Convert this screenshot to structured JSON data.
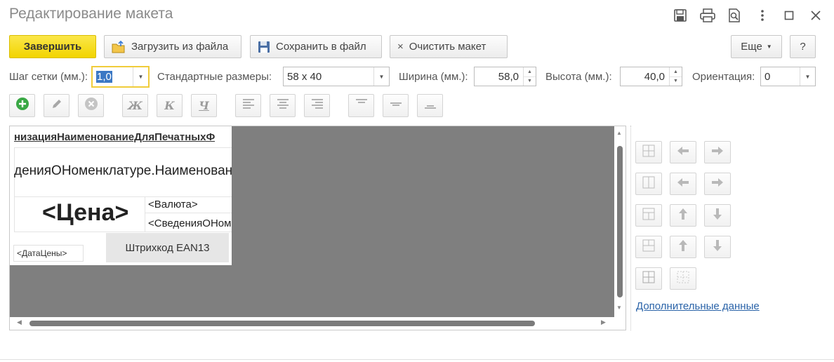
{
  "window": {
    "title": "Редактирование макета",
    "controls": [
      "save-icon",
      "print-icon",
      "preview-icon",
      "more-icon",
      "maximize-icon",
      "close-icon"
    ]
  },
  "toolbar": {
    "finish_label": "Завершить",
    "load_label": "Загрузить из файла",
    "save_label": "Сохранить в файл",
    "clear_label": "Очистить макет",
    "more_label": "Еще",
    "help_label": "?"
  },
  "params": {
    "grid_step_label": "Шаг сетки (мм.):",
    "grid_step_value": "1,0",
    "std_sizes_label": "Стандартные размеры:",
    "std_sizes_value": "58 x 40",
    "width_label": "Ширина (мм.):",
    "width_value": "58,0",
    "height_label": "Высота (мм.):",
    "height_value": "40,0",
    "orientation_label": "Ориентация:",
    "orientation_value": "0"
  },
  "format_toolbar": {
    "bold": "Ж",
    "italic": "К",
    "underline": "Ч"
  },
  "label": {
    "org_name": "низацияНаименованиеДляПечатныхФ",
    "nomenclature": "денияОНоменклатуре.Наименование",
    "price": "<Цена>",
    "currency": "<Валюта>",
    "info": "<СведенияОНоменклатуре>",
    "barcode": "Штрихкод EAN13",
    "price_date": "<ДатаЦены>"
  },
  "side": {
    "extra_data_link": "Дополнительные данные"
  },
  "colors": {
    "accent": "#f2d400",
    "canvas_bg": "#7f7f7f",
    "link": "#2a63a8"
  }
}
